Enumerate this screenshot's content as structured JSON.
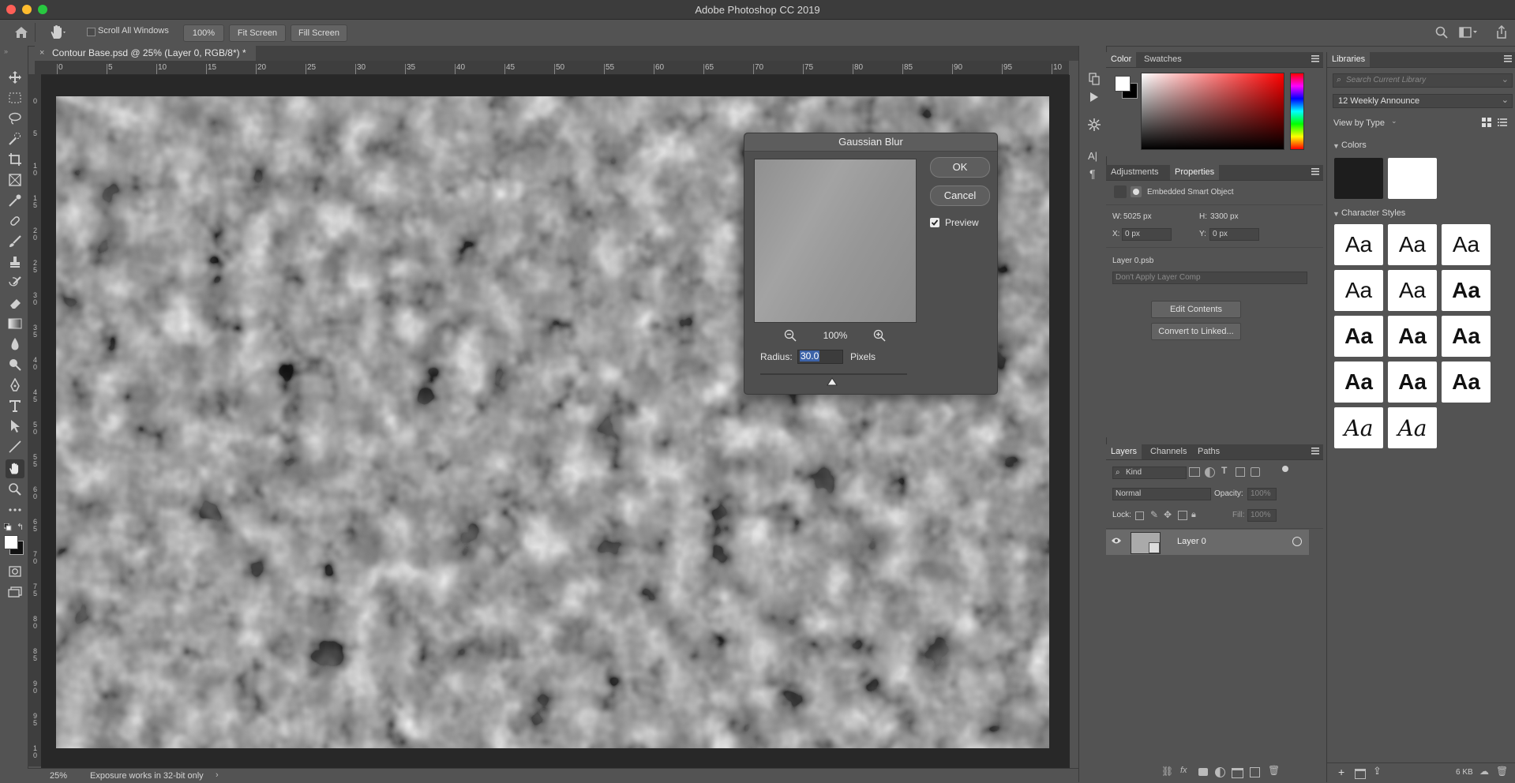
{
  "app": {
    "title": "Adobe Photoshop CC 2019"
  },
  "options": {
    "scroll_all_windows": "Scroll All Windows",
    "zoom_100": "100%",
    "fit_screen": "Fit Screen",
    "fill_screen": "Fill Screen"
  },
  "document": {
    "tab_title": "Contour Base.psd @ 25% (Layer 0, RGB/8*) *"
  },
  "ruler": {
    "top_ticks": [
      "0",
      "5",
      "10",
      "15",
      "20",
      "25",
      "30",
      "35",
      "40",
      "45",
      "50",
      "55",
      "60",
      "65",
      "70",
      "75",
      "80",
      "85",
      "90",
      "95",
      "10"
    ],
    "left_ticks": [
      "0",
      "5",
      "1 0",
      "1 5",
      "2 0",
      "2 5",
      "3 0",
      "3 5",
      "4 0",
      "4 5",
      "5 0",
      "5 5",
      "6 0",
      "6 5",
      "7 0",
      "7 5",
      "8 0",
      "8 5",
      "9 0",
      "9 5",
      "1 0"
    ]
  },
  "status": {
    "zoom": "25%",
    "message": "Exposure works in 32-bit only"
  },
  "dialog": {
    "title": "Gaussian Blur",
    "ok": "OK",
    "cancel": "Cancel",
    "preview_label": "Preview",
    "preview_checked": true,
    "preview_zoom": "100%",
    "radius_label": "Radius:",
    "radius_value": "30.0",
    "radius_unit": "Pixels"
  },
  "color_panel": {
    "tabs": [
      "Color",
      "Swatches"
    ]
  },
  "properties_panel": {
    "tabs": [
      "Adjustments",
      "Properties"
    ],
    "type_label": "Embedded Smart Object",
    "w_label": "W:",
    "w_value": "5025 px",
    "h_label": "H:",
    "h_value": "3300 px",
    "x_label": "X:",
    "x_value": "0 px",
    "y_label": "Y:",
    "y_value": "0 px",
    "file_name": "Layer 0.psb",
    "layer_comp": "Don't Apply Layer Comp",
    "edit_contents": "Edit Contents",
    "convert_linked": "Convert to Linked..."
  },
  "layers_panel": {
    "tabs": [
      "Layers",
      "Channels",
      "Paths"
    ],
    "filter_kind": "Kind",
    "blend_mode": "Normal",
    "opacity_label": "Opacity:",
    "opacity_value": "100%",
    "lock_label": "Lock:",
    "fill_label": "Fill:",
    "fill_value": "100%",
    "layers": [
      {
        "name": "Layer 0",
        "visible": true
      }
    ]
  },
  "libraries_panel": {
    "tab": "Libraries",
    "search_placeholder": "Search Current Library",
    "library_name": "12 Weekly Announce",
    "view_by": "View by Type",
    "colors_header": "Colors",
    "char_styles_header": "Character Styles",
    "swatch_colors": [
      "#1d1d1d",
      "#ffffff"
    ],
    "sample": "Aa",
    "size_label": "6 KB"
  }
}
